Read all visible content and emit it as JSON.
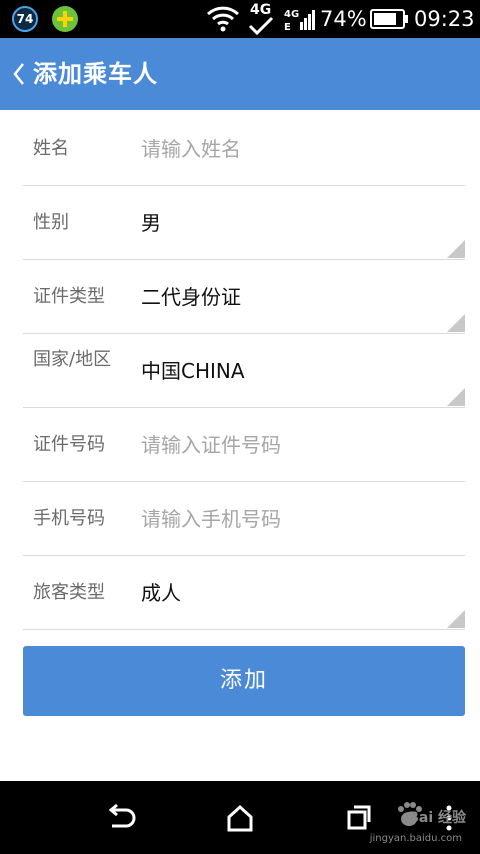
{
  "status_bar": {
    "notification_count": "74",
    "network_type": "4G",
    "battery_percent": "74%",
    "time": "09:23",
    "icons": [
      "notification-count-badge",
      "plus-app-icon",
      "wifi-icon",
      "4g-signal-icon",
      "cell-signal-icon",
      "battery-icon"
    ]
  },
  "header": {
    "back_icon": "chevron-left-icon",
    "title": "添加乘车人"
  },
  "form": {
    "name": {
      "label": "姓名",
      "placeholder": "请输入姓名",
      "value": ""
    },
    "gender": {
      "label": "性别",
      "value": "男"
    },
    "id_type": {
      "label": "证件类型",
      "value": "二代身份证"
    },
    "country": {
      "label": "国家/地区",
      "value": "中国CHINA"
    },
    "id_number": {
      "label": "证件号码",
      "placeholder": "请输入证件号码",
      "value": ""
    },
    "phone": {
      "label": "手机号码",
      "placeholder": "请输入手机号码",
      "value": ""
    },
    "passenger_type": {
      "label": "旅客类型",
      "value": "成人"
    }
  },
  "actions": {
    "add_label": "添加"
  },
  "nav_bar": {
    "icons": [
      "back-nav-icon",
      "home-nav-icon",
      "recent-apps-icon",
      "overflow-menu-icon"
    ]
  },
  "watermark": {
    "text": "Bai 经验",
    "url_text": "jingyan.baidu.com"
  },
  "colors": {
    "primary": "#4a8ad7",
    "label": "#6b6b6b",
    "placeholder": "#a6a6a6",
    "divider": "#dcdcdc"
  }
}
